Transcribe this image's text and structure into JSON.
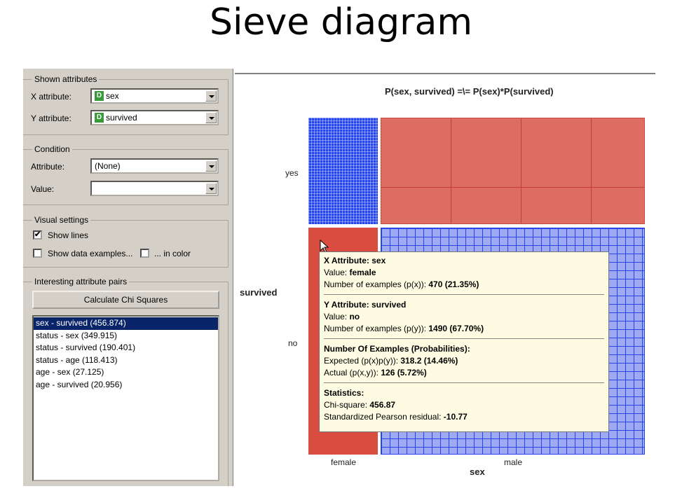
{
  "title": "Sieve diagram",
  "shown_attributes": {
    "group_label": "Shown attributes",
    "x_label": "X attribute:",
    "x_icon": "D",
    "x_value": "sex",
    "y_label": "Y attribute:",
    "y_icon": "D",
    "y_value": "survived"
  },
  "condition": {
    "group_label": "Condition",
    "attribute_label": "Attribute:",
    "attribute_value": "(None)",
    "value_label": "Value:",
    "value_value": ""
  },
  "visual_settings": {
    "group_label": "Visual settings",
    "show_lines_label": "Show lines",
    "show_lines_checked": true,
    "show_examples_label": "Show data examples...",
    "show_examples_checked": false,
    "in_color_label": "... in color",
    "in_color_checked": false
  },
  "pairs": {
    "group_label": "Interesting attribute pairs",
    "button_label": "Calculate Chi Squares",
    "items": [
      "sex - survived (456.874)",
      "status - sex (349.915)",
      "status - survived (190.401)",
      "status - age (118.413)",
      "age - sex (27.125)",
      "age - survived (20.956)"
    ],
    "selected_index": 0
  },
  "diagram": {
    "formula": "P(sex, survived) =\\= P(sex)*P(survived)",
    "y_title": "survived",
    "y_labels": [
      "yes",
      "no"
    ],
    "x_title": "sex",
    "x_labels": [
      "female",
      "male"
    ]
  },
  "tooltip": {
    "x_header": "X Attribute: sex",
    "x_value_prefix": "Value: ",
    "x_value": "female",
    "x_count_prefix": "Number of examples (p(x)): ",
    "x_count": "470 (21.35%)",
    "y_header": "Y Attribute: survived",
    "y_value_prefix": "Value: ",
    "y_value": "no",
    "y_count_prefix": "Number of examples (p(y)): ",
    "y_count": "1490 (67.70%)",
    "prob_header": "Number Of Examples (Probabilities):",
    "expected_prefix": "Expected (p(x)p(y)): ",
    "expected": "318.2 (14.46%)",
    "actual_prefix": "Actual (p(x,y)): ",
    "actual": "126 (5.72%)",
    "stats_header": "Statistics:",
    "chi_prefix": "Chi-square: ",
    "chi": "456.87",
    "residual_prefix": "Standardized Pearson residual: ",
    "residual": "-10.77"
  },
  "colors": {
    "positive_residual": "#2444ee",
    "negative_residual": "#dd6d62",
    "panel_bg": "#d4d0c8",
    "selection": "#0a246a",
    "tooltip_bg": "#fdfbe2"
  }
}
